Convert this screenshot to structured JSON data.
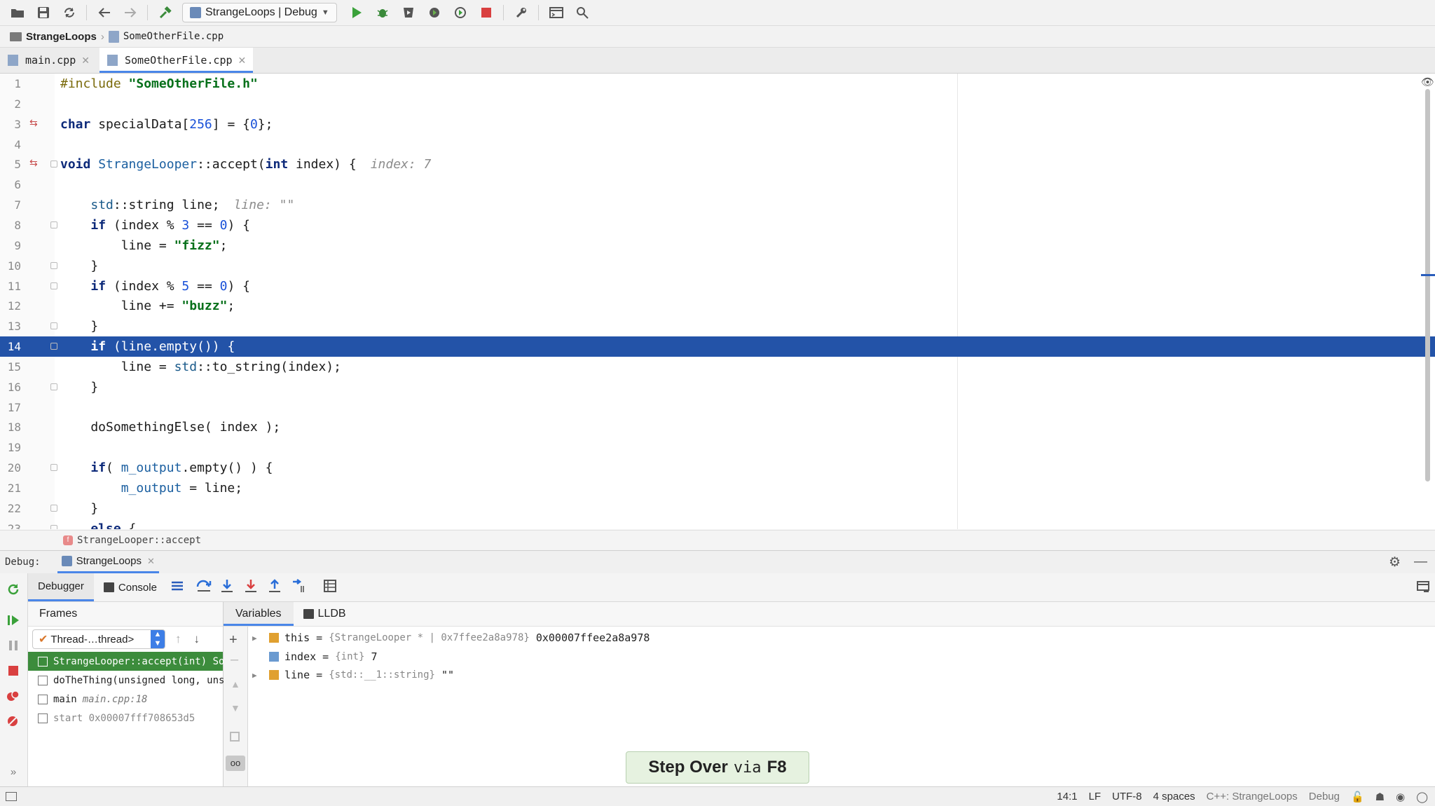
{
  "toolbar": {
    "run_config": "StrangeLoops | Debug"
  },
  "breadcrumb": {
    "project": "StrangeLoops",
    "file": "SomeOtherFile.cpp"
  },
  "tabs": [
    {
      "label": "main.cpp"
    },
    {
      "label": "SomeOtherFile.cpp"
    }
  ],
  "editor": {
    "current_line": 14,
    "lines": [
      {
        "n": "1",
        "text": "#include \"SomeOtherFile.h\""
      },
      {
        "n": "2",
        "text": ""
      },
      {
        "n": "3",
        "text": "char specialData[256] = {0};"
      },
      {
        "n": "4",
        "text": ""
      },
      {
        "n": "5",
        "text": "void StrangeLooper::accept(int index) {",
        "inline": "index: 7"
      },
      {
        "n": "6",
        "text": ""
      },
      {
        "n": "7",
        "text": "    std::string line;",
        "inline": "line: \"\""
      },
      {
        "n": "8",
        "text": "    if (index % 3 == 0) {"
      },
      {
        "n": "9",
        "text": "        line = \"fizz\";"
      },
      {
        "n": "10",
        "text": "    }"
      },
      {
        "n": "11",
        "text": "    if (index % 5 == 0) {"
      },
      {
        "n": "12",
        "text": "        line += \"buzz\";"
      },
      {
        "n": "13",
        "text": "    }"
      },
      {
        "n": "14",
        "text": "    if (line.empty()) {"
      },
      {
        "n": "15",
        "text": "        line = std::to_string(index);"
      },
      {
        "n": "16",
        "text": "    }"
      },
      {
        "n": "17",
        "text": ""
      },
      {
        "n": "18",
        "text": "    doSomethingElse( index );"
      },
      {
        "n": "19",
        "text": ""
      },
      {
        "n": "20",
        "text": "    if( m_output.empty() ) {"
      },
      {
        "n": "21",
        "text": "        m_output = line;"
      },
      {
        "n": "22",
        "text": "    }"
      },
      {
        "n": "23",
        "text": "    else {"
      }
    ]
  },
  "context": {
    "function": "StrangeLooper::accept"
  },
  "debug": {
    "label": "Debug:",
    "session": "StrangeLoops",
    "tabs": {
      "debugger": "Debugger",
      "console": "Console"
    },
    "frames_title": "Frames",
    "thread": "Thread-…thread>",
    "frames": [
      {
        "name": "StrangeLooper::accept(int) So",
        "loc": ""
      },
      {
        "name": "doTheThing(unsigned long, uns",
        "loc": ""
      },
      {
        "name": "main",
        "loc": "main.cpp:18"
      },
      {
        "name": "start 0x00007fff708653d5",
        "loc": ""
      }
    ],
    "vars_tabs": {
      "variables": "Variables",
      "lldb": "LLDB"
    },
    "variables": [
      {
        "name": "this",
        "type": "{StrangeLooper * | 0x7ffee2a8a978}",
        "value": "0x00007ffee2a8a978"
      },
      {
        "name": "index",
        "type": "{int}",
        "value": "7"
      },
      {
        "name": "line",
        "type": "{std::__1::string}",
        "value": "\"\""
      }
    ]
  },
  "tooltip": {
    "prefix": "Step Over",
    "via": "via",
    "key": "F8"
  },
  "status": {
    "position": "14:1",
    "line_sep": "LF",
    "encoding": "UTF-8",
    "indent": "4 spaces",
    "context": "C++: StrangeLoops",
    "config": "Debug"
  }
}
